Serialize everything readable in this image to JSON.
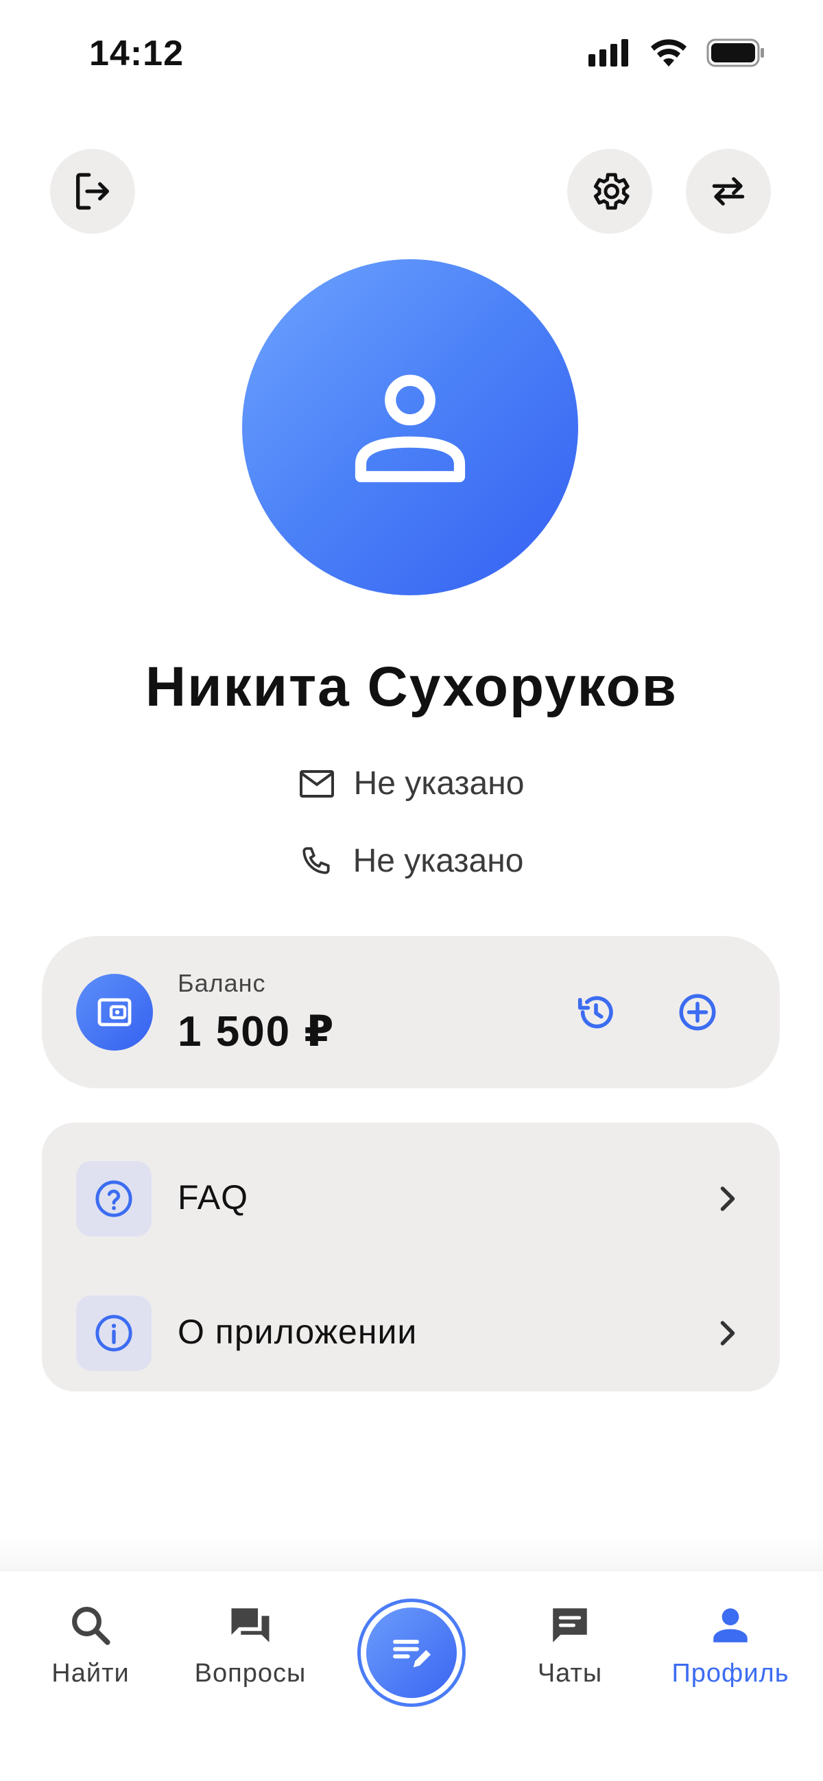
{
  "status_bar": {
    "time": "14:12"
  },
  "profile": {
    "name": "Никита Сухоруков",
    "email": "Не указано",
    "phone": "Не указано"
  },
  "balance": {
    "label": "Баланс",
    "value": "1 500 ₽"
  },
  "menu": {
    "items": [
      {
        "label": "FAQ",
        "icon": "question-icon"
      },
      {
        "label": "О приложении",
        "icon": "info-icon"
      }
    ]
  },
  "bottom_nav": {
    "items": [
      {
        "label": "Найти",
        "icon": "search-icon"
      },
      {
        "label": "Вопросы",
        "icon": "forum-icon"
      },
      {
        "label": "Чаты",
        "icon": "chat-icon"
      },
      {
        "label": "Профиль",
        "icon": "person-icon",
        "active": true
      }
    ]
  },
  "colors": {
    "accent": "#3c6cf1",
    "card_background": "#efedec"
  }
}
